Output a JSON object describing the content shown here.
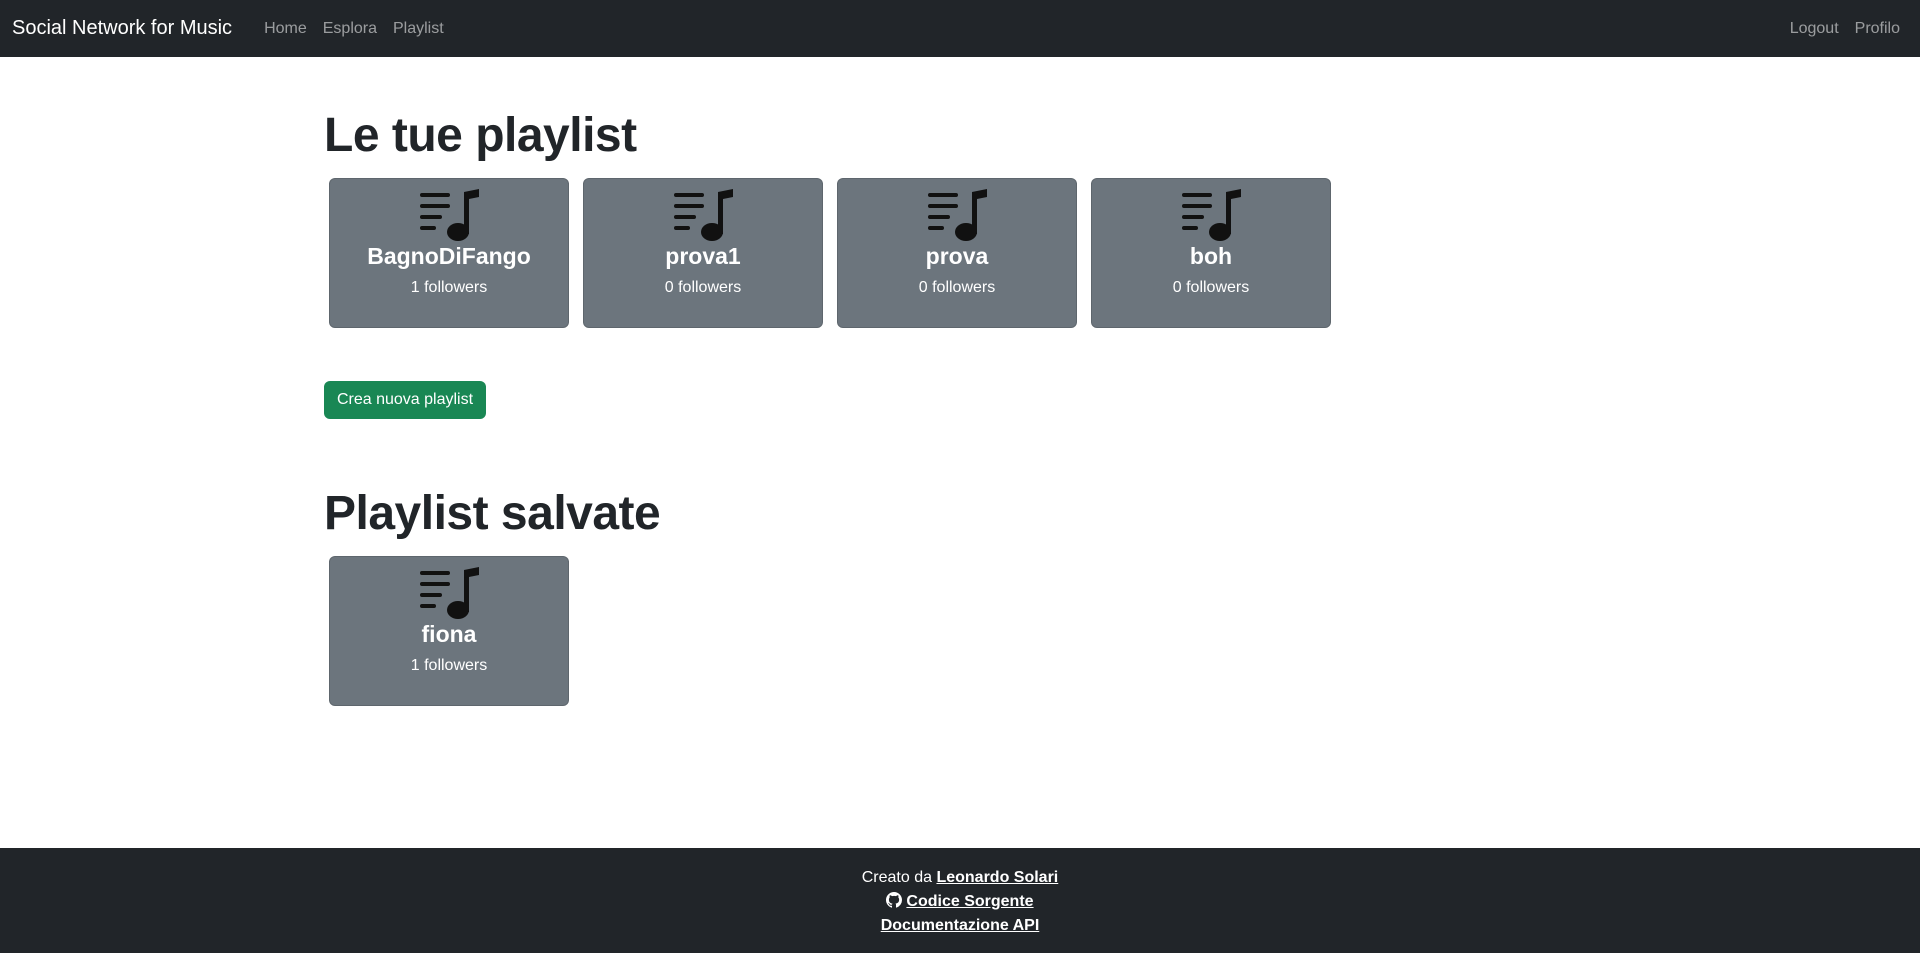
{
  "navbar": {
    "brand": "Social Network for Music",
    "left_links": [
      "Home",
      "Esplora",
      "Playlist"
    ],
    "right_links": [
      "Logout",
      "Profilo"
    ]
  },
  "sections": {
    "my_playlists": {
      "title": "Le tue playlist",
      "cards": [
        {
          "name": "BagnoDiFango",
          "followers": "1 followers"
        },
        {
          "name": "prova1",
          "followers": "0 followers"
        },
        {
          "name": "prova",
          "followers": "0 followers"
        },
        {
          "name": "boh",
          "followers": "0 followers"
        }
      ],
      "create_button": "Crea nuova playlist"
    },
    "saved_playlists": {
      "title": "Playlist salvate",
      "cards": [
        {
          "name": "fiona",
          "followers": "1 followers"
        }
      ]
    }
  },
  "footer": {
    "created_by_prefix": "Creato da",
    "author": "Leonardo Solari",
    "source_link": "Codice Sorgente",
    "api_link": "Documentazione API"
  },
  "icons": {
    "card_icon": "playlist-music-icon",
    "footer_icon": "github-icon"
  },
  "colors": {
    "navbar_bg": "#212529",
    "card_bg": "#6c757d",
    "button_success": "#198754",
    "footer_bg": "#212529"
  }
}
